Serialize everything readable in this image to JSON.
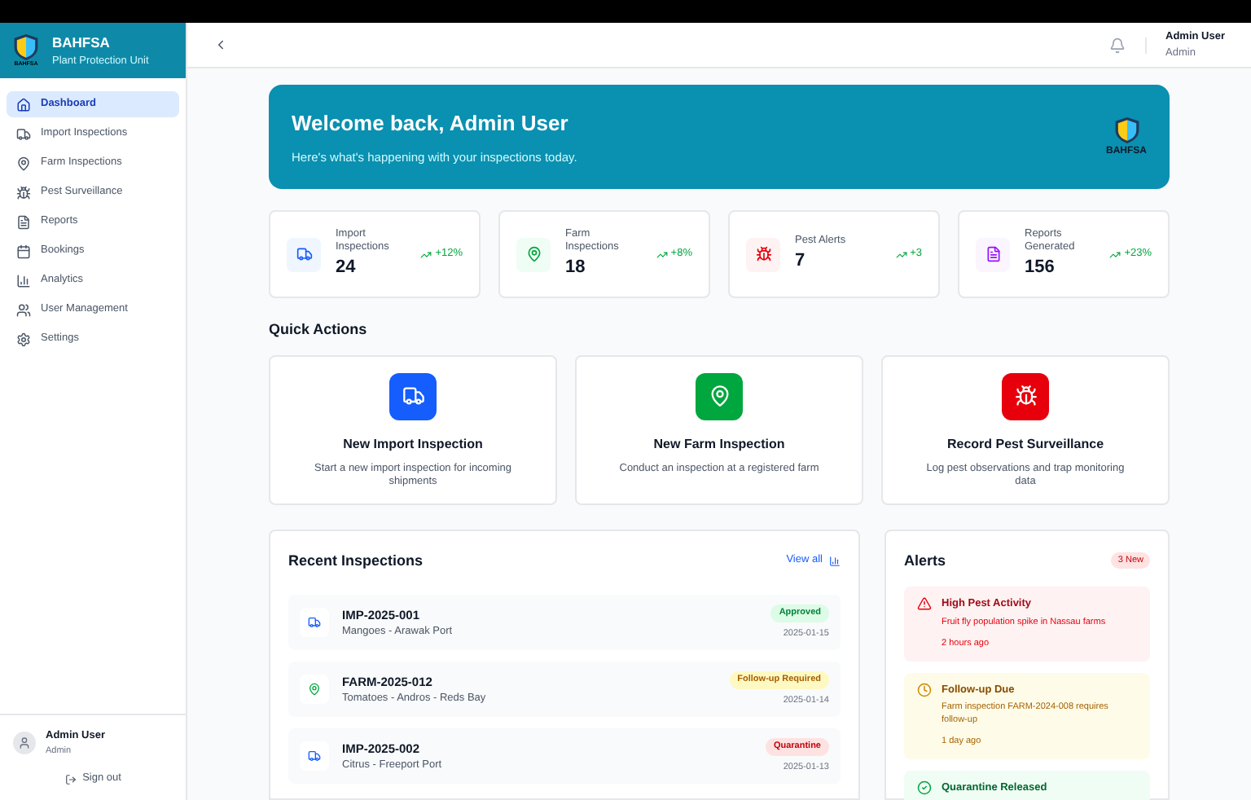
{
  "brand": {
    "name": "BAHFSA",
    "subtitle": "Plant Protection Unit",
    "logo_text": "BAHFSA"
  },
  "sidebar": {
    "items": [
      {
        "label": "Dashboard",
        "kind": "home",
        "selected": true
      },
      {
        "label": "Import Inspections",
        "kind": "truck",
        "selected": false
      },
      {
        "label": "Farm Inspections",
        "kind": "pin",
        "selected": false
      },
      {
        "label": "Pest Surveillance",
        "kind": "bug",
        "selected": false
      },
      {
        "label": "Reports",
        "kind": "file",
        "selected": false
      },
      {
        "label": "Bookings",
        "kind": "calendar",
        "selected": false
      },
      {
        "label": "Analytics",
        "kind": "chart",
        "selected": false
      },
      {
        "label": "User Management",
        "kind": "users",
        "selected": false
      },
      {
        "label": "Settings",
        "kind": "gear",
        "selected": false
      }
    ],
    "user": {
      "name": "Admin User",
      "role": "Admin"
    },
    "sign_out": "Sign out"
  },
  "header": {
    "user_name": "Admin User",
    "user_role": "Admin"
  },
  "banner": {
    "title": "Welcome back, Admin User",
    "subtitle": "Here's what's happening with your inspections today.",
    "logo_text": "BAHFSA"
  },
  "stats": [
    {
      "label": "Import Inspections",
      "value": "24",
      "change": "+12%",
      "kind": "truck"
    },
    {
      "label": "Farm Inspections",
      "value": "18",
      "change": "+8%",
      "kind": "pin"
    },
    {
      "label": "Pest Alerts",
      "value": "7",
      "change": "+3",
      "kind": "bug"
    },
    {
      "label": "Reports Generated",
      "value": "156",
      "change": "+23%",
      "kind": "file"
    }
  ],
  "quick_actions": {
    "title": "Quick Actions",
    "items": [
      {
        "title": "New Import Inspection",
        "description": "Start a new import inspection for incoming shipments",
        "kind": "truck"
      },
      {
        "title": "New Farm Inspection",
        "description": "Conduct an inspection at a registered farm",
        "kind": "pin"
      },
      {
        "title": "Record Pest Surveillance",
        "description": "Log pest observations and trap monitoring data",
        "kind": "bug"
      }
    ]
  },
  "recent_inspections": {
    "title": "Recent Inspections",
    "view_all": "View all",
    "rows": [
      {
        "id": "IMP-2025-001",
        "detail": "Mangoes - Arawak Port",
        "status": "Approved",
        "color": "#dcfce7",
        "date": "2025-01-15",
        "kind": "truck"
      },
      {
        "id": "FARM-2025-012",
        "detail": "Tomatoes - Andros - Reds Bay",
        "status": "Follow-up Required",
        "color": "#fef9c3",
        "date": "2025-01-14",
        "kind": "pin"
      },
      {
        "id": "IMP-2025-002",
        "detail": "Citrus - Freeport Port",
        "status": "Quarantine",
        "color": "#fee2e2",
        "date": "2025-01-13",
        "kind": "truck"
      }
    ]
  },
  "alerts": {
    "title": "Alerts",
    "badge": "3 New",
    "items": [
      {
        "title": "High Pest Activity",
        "message": "Fruit fly population spike in Nassau farms",
        "time": "2 hours ago",
        "kind": "danger"
      },
      {
        "title": "Follow-up Due",
        "message": "Farm inspection FARM-2024-008 requires follow-up",
        "time": "1 day ago",
        "kind": "warning"
      },
      {
        "title": "Quarantine Released",
        "kind": "success"
      }
    ]
  }
}
